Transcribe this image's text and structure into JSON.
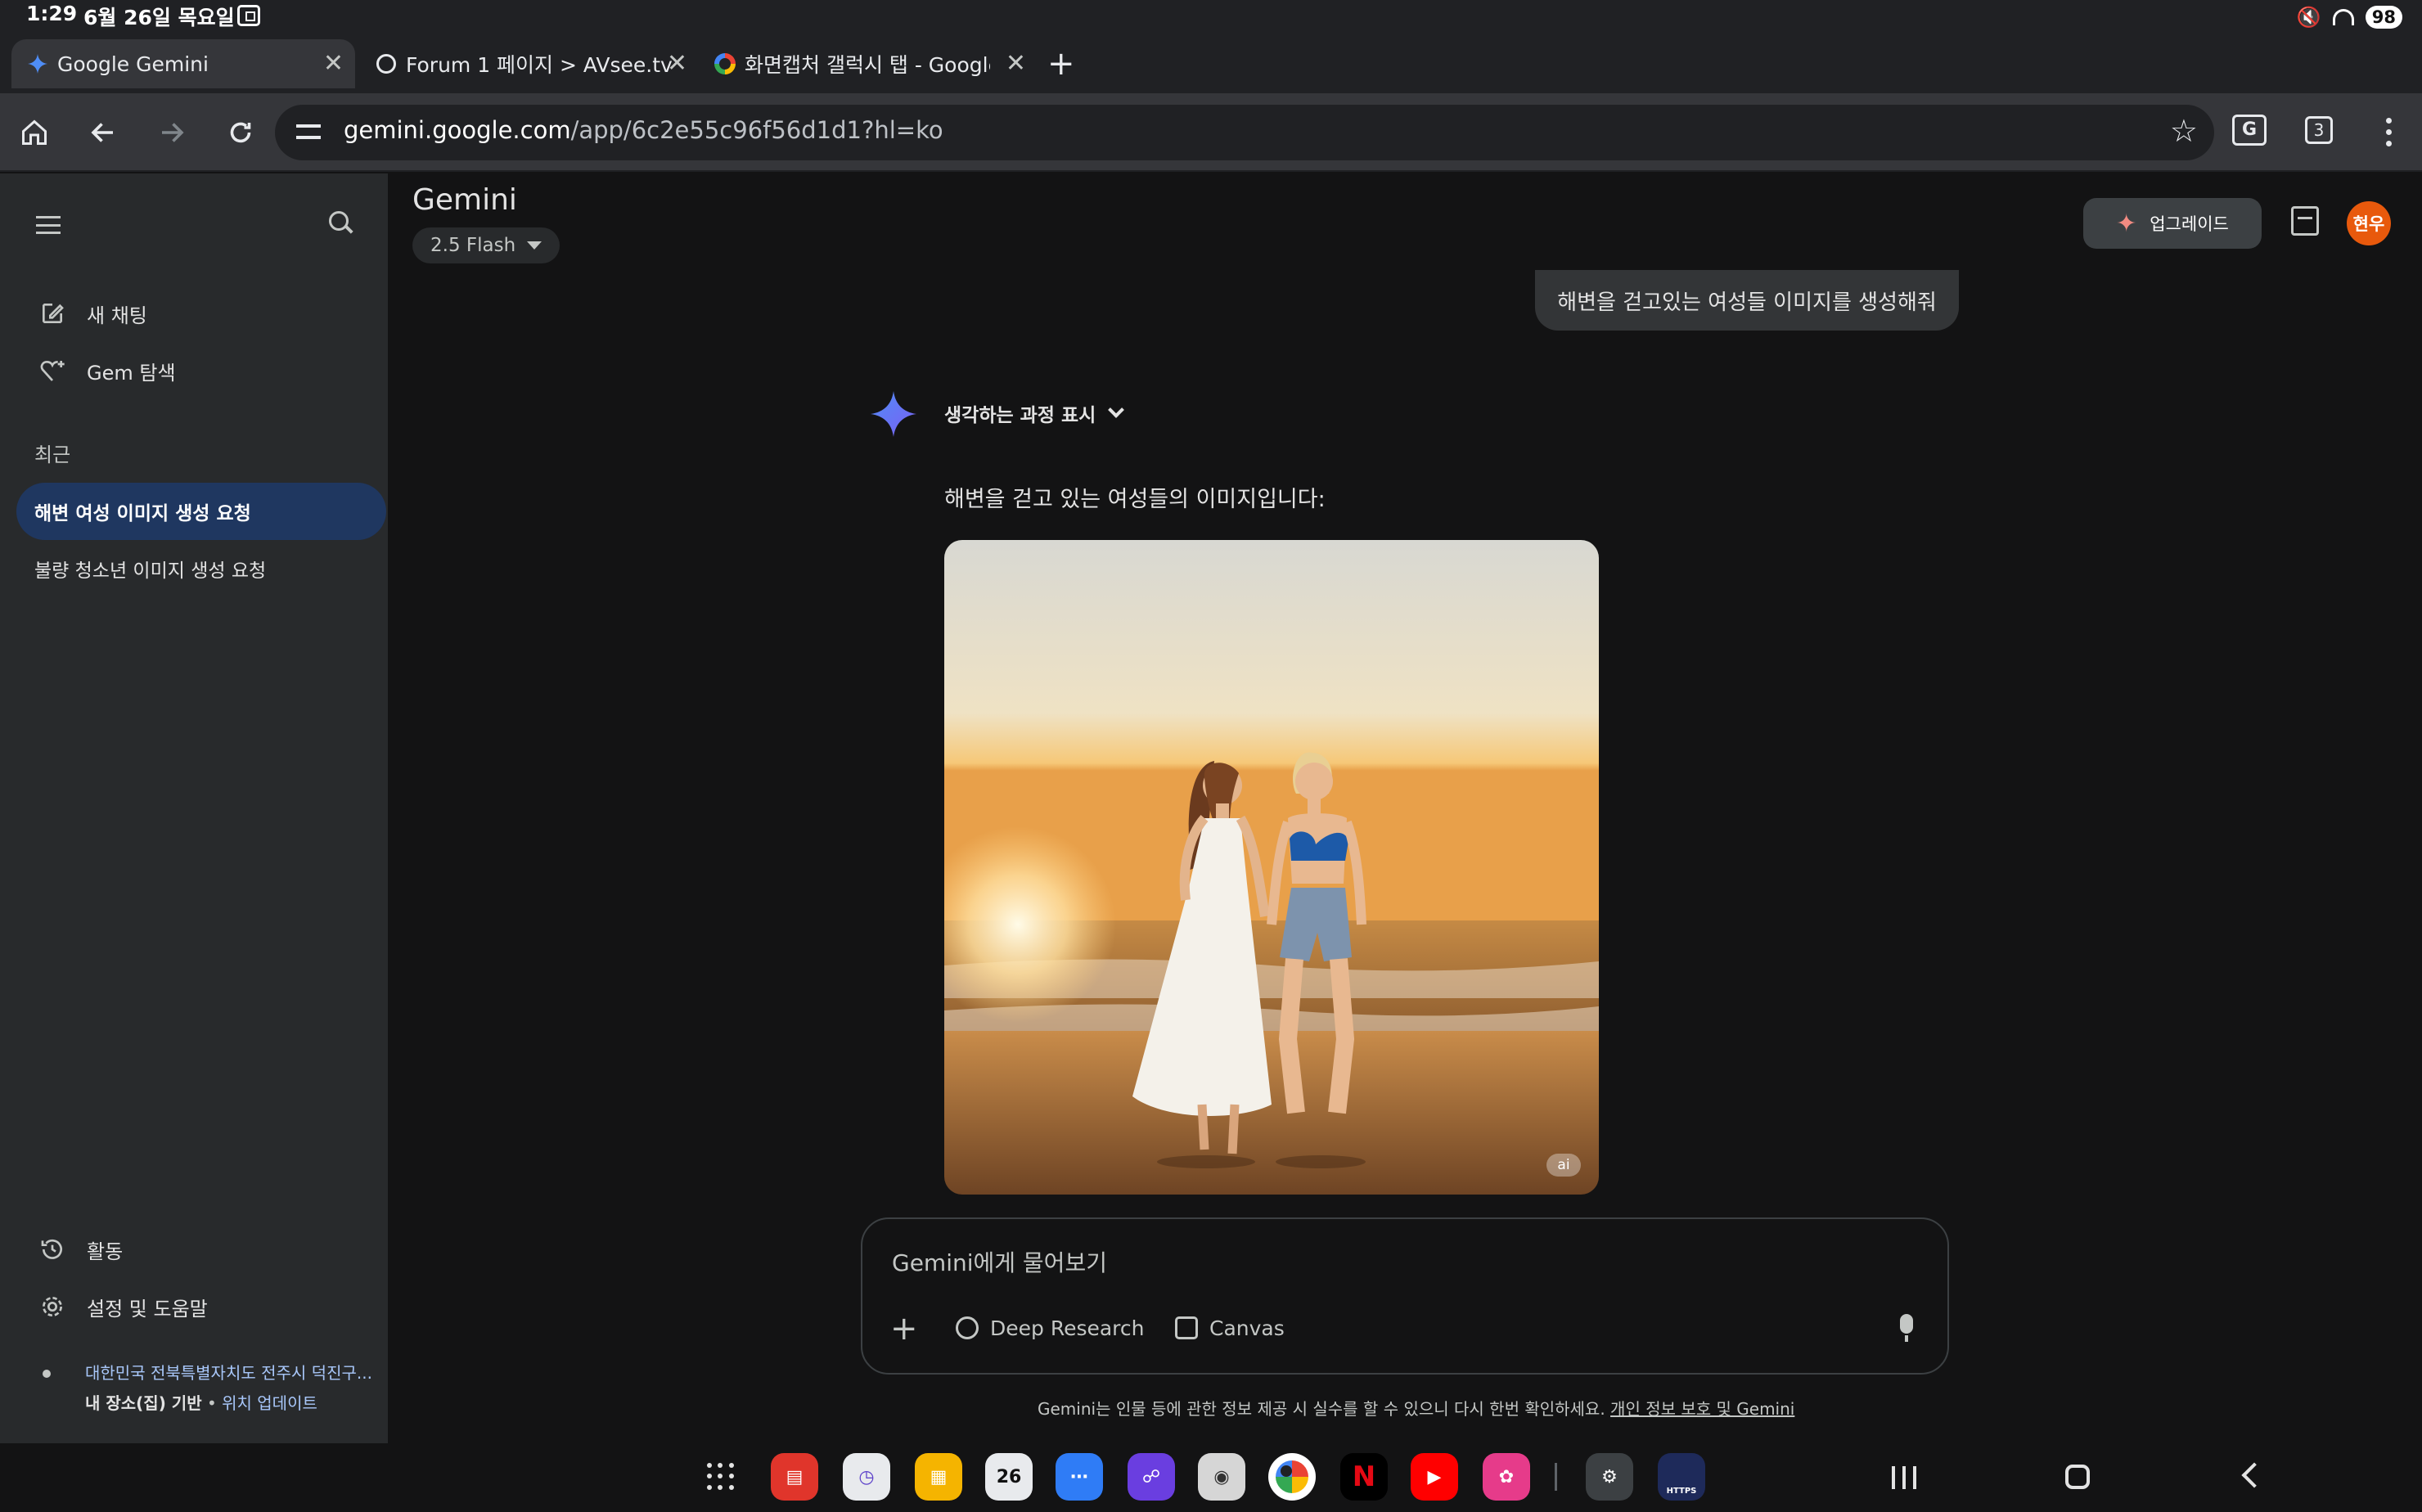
{
  "status_bar": {
    "time": "1:29",
    "date": "6월 26일 목요일",
    "battery": "98"
  },
  "tabs": [
    {
      "title": "Google Gemini",
      "icon": "gemini-spark-icon",
      "active": true
    },
    {
      "title": "Forum 1 페이지 > AVsee.tv",
      "icon": "globe-icon",
      "active": false
    },
    {
      "title": "화면캡처 갤럭시 탭 - Google 검",
      "icon": "google-logo-icon",
      "active": false
    }
  ],
  "toolbar": {
    "url_host": "gemini.google.com",
    "url_path": "/app/6c2e55c96f56d1d1?hl=ko",
    "tab_count": "3",
    "translate_label": "G"
  },
  "sidebar": {
    "items": [
      {
        "label": "새 채팅",
        "icon": "edit-icon"
      },
      {
        "label": "Gem 탐색",
        "icon": "gem-icon"
      }
    ],
    "section_title": "최근",
    "recent": [
      {
        "label": "해변 여성 이미지 생성 요청",
        "active": true
      },
      {
        "label": "불량 청소년 이미지 생성 요청",
        "active": false
      }
    ],
    "bottom_items": [
      {
        "label": "활동",
        "icon": "history-icon"
      },
      {
        "label": "설정 및 도움말",
        "icon": "settings-icon"
      }
    ],
    "location": {
      "line1": "대한민국 전북특별자치도 전주시 덕진구...",
      "basis": "내 장소(집) 기반",
      "separator": " • ",
      "update_link": "위치 업데이트"
    }
  },
  "header": {
    "title": "Gemini",
    "model": "2.5 Flash",
    "upgrade_label": "업그레이드",
    "avatar_text": "현우"
  },
  "chat": {
    "user_message": "해변을 걷고있는 여성들 이미지를 생성해줘",
    "thinking_label": "생각하는 과정 표시",
    "response_text": "해변을 걷고 있는 여성들의 이미지입니다:",
    "image_badge": "ai"
  },
  "input": {
    "placeholder": "Gemini에게 물어보기",
    "tools": [
      {
        "label": "Deep Research",
        "icon": "deep-research-icon"
      },
      {
        "label": "Canvas",
        "icon": "canvas-icon"
      }
    ]
  },
  "disclaimer": {
    "text": "Gemini는 인물 등에 관한 정보 제공 시 실수를 할 수 있으니 다시 한번 확인하세요. ",
    "link": "개인 정보 보호 및 Gemini"
  },
  "dock": {
    "calendar_day": "26",
    "https_label": "HTTPS"
  }
}
